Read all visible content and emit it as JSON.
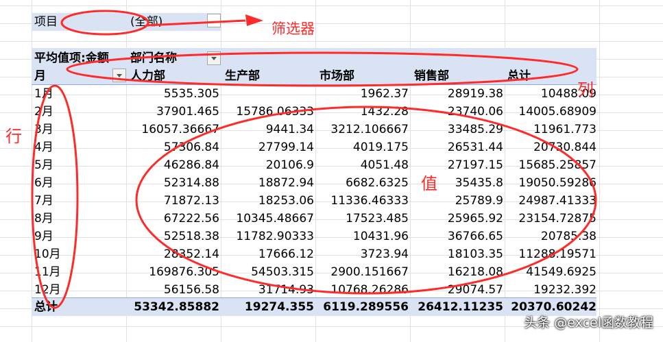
{
  "filter": {
    "label": "项目",
    "value": "(全部)"
  },
  "pivot": {
    "value_title": "平均值项:金额",
    "column_field": "部门名称",
    "row_field": "月",
    "columns": [
      "人力部",
      "生产部",
      "市场部",
      "销售部",
      "总计"
    ],
    "rows": [
      {
        "month": "1月",
        "cells": [
          "5535.305",
          "",
          "1962.37",
          "28919.38",
          "10488.09"
        ]
      },
      {
        "month": "2月",
        "cells": [
          "37901.465",
          "15786.06333",
          "1432.28",
          "23740.06",
          "14005.68909"
        ]
      },
      {
        "month": "3月",
        "cells": [
          "16057.36667",
          "9441.34",
          "3212.106667",
          "33485.29",
          "11961.773"
        ]
      },
      {
        "month": "4月",
        "cells": [
          "57306.84",
          "27799.14",
          "4019.175",
          "26531.44",
          "20730.844"
        ]
      },
      {
        "month": "5月",
        "cells": [
          "46286.84",
          "20106.9",
          "4051.48",
          "27197.15",
          "15685.25857"
        ]
      },
      {
        "month": "6月",
        "cells": [
          "52314.88",
          "18872.94",
          "6682.6325",
          "35435.8",
          "19050.59286"
        ]
      },
      {
        "month": "7月",
        "cells": [
          "71872.13",
          "18253.06",
          "11336.46333",
          "25789.9",
          "24987.41333"
        ]
      },
      {
        "month": "8月",
        "cells": [
          "67222.56",
          "10345.48667",
          "17523.485",
          "25965.92",
          "23154.72875"
        ]
      },
      {
        "month": "9月",
        "cells": [
          "52518.38",
          "11782.90333",
          "10431.96",
          "36766.65",
          "20785.38"
        ]
      },
      {
        "month": "10月",
        "cells": [
          "28352.14",
          "17666.12",
          "3723.94",
          "18103.35",
          "11288.19571"
        ]
      },
      {
        "month": "11月",
        "cells": [
          "169876.305",
          "54503.315",
          "2900.151667",
          "16218.08",
          "41549.6925"
        ]
      },
      {
        "month": "12月",
        "cells": [
          "56156.58",
          "31714.93",
          "10768.26286",
          "29074.57",
          "19232.392"
        ]
      }
    ],
    "total": {
      "label": "总计",
      "cells": [
        "53342.85882",
        "19274.355",
        "6119.289556",
        "26412.11235",
        "20370.60242"
      ]
    }
  },
  "annotations": {
    "filter_label": "筛选器",
    "column_label": "列",
    "row_label": "行",
    "value_label": "值",
    "color": "#ff2a2a"
  },
  "watermark": "头条 @excel函数教程"
}
